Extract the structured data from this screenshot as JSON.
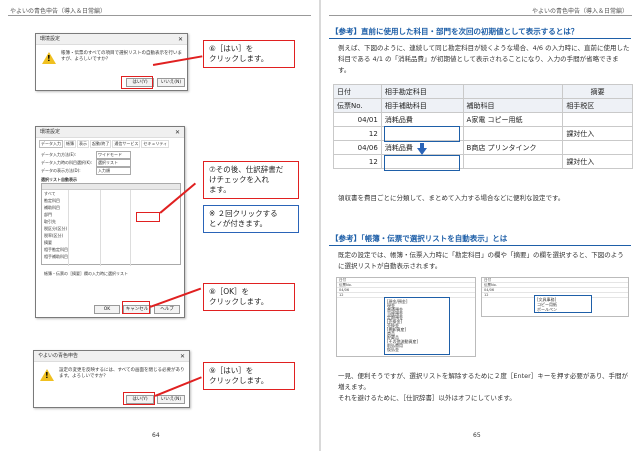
{
  "header_left": "やよいの青色申告（導入＆日常編）",
  "header_right": "やよいの青色申告（導入＆日常編）",
  "page_left": "64",
  "page_right": "65",
  "dialog1": {
    "title": "環境設定",
    "message": "帳簿・伝票のすべての項目で選択リストの自動表示を行いますが、よろしいですか？",
    "yes": "はい(Y)",
    "no": "いいえ(N)"
  },
  "callout6": "⑥［はい］を\nクリックします。",
  "settings": {
    "title": "環境設定",
    "tabs": [
      "データ入力",
      "帳簿",
      "表示",
      "起動/終了",
      "通信サービス",
      "セキュリティ"
    ],
    "rows": [
      {
        "label": "データ入力方法(E):",
        "value": "ワイドモード"
      },
      {
        "label": "データ入力時の科目選択(K):",
        "value": "選択リスト"
      },
      {
        "label": "データの表示方法(D):",
        "value": "入力順"
      }
    ],
    "grid_title": "選択リスト自動表示",
    "grid_headers": [
      "",
      "データ入力伝票",
      "データ出力伝票",
      "振替伝票",
      "帳簿（仕訳帳以外）",
      "仕訳帳"
    ],
    "grid_rows": [
      "すべて",
      "勘定科目",
      "補助科目",
      "部門",
      "取引先",
      "税区分(区分)",
      "税率(区分)",
      "摘要",
      "相手勘定科目",
      "相手補助科目"
    ],
    "checkbox_label": "帳簿・伝票の［摘要］欄の入力時に選択リスト",
    "ok": "OK",
    "cancel": "キャンセル",
    "help": "ヘルプ"
  },
  "callout7": "⑦その後、仕訳辞書だ\nけチェックを入れ\nます。",
  "note_blue": "※ ２回クリックする\nと✓が付きます。",
  "callout8": "⑧［OK］を\nクリックします。",
  "dialog2": {
    "title": "やよいの青色申告",
    "message": "設定の変更を反映するには、すべての画面を閉じる必要があります。よろしいですか？",
    "yes": "はい(Y)",
    "no": "いいえ(N)"
  },
  "callout9": "⑨［はい］を\nクリックします。",
  "section1": {
    "heading": "【参考】直前に使用した科目・部門を次回の初期値として表示するとは？",
    "para": "例えば、下図のように、連続して同じ勘定科目が続くような場合、4/6 の入力時に、直前に使用した科目である 4/1 の「消耗品費」が初期値として表示されることになり、入力の手間が省略できます。",
    "table": {
      "h1": [
        "日付",
        "相手勘定科目",
        "摘要"
      ],
      "h2": [
        "伝票No.",
        "相手補助科目",
        "補助科目",
        "相手税区"
      ],
      "rows": [
        [
          "04/01",
          "消耗品費",
          "A家電  コピー用紙",
          ""
        ],
        [
          "12",
          "",
          "",
          "課対仕入"
        ],
        [
          "04/06",
          "消耗品費",
          "B商店  プリンタインク",
          ""
        ],
        [
          "12",
          "",
          "",
          "課対仕入"
        ]
      ]
    },
    "after": "領収書を費目ごとに分類して、まとめて入力する場合などに便利な設定です。"
  },
  "section2": {
    "heading": "【参考】「帳簿・伝票で選択リストを自動表示」とは",
    "para": "既定の設定では、帳簿・伝票入力時に「勘定科目」の欄や「摘要」の欄を選択すると、下図のように選択リストが自動表示されます。",
    "mini_left": [
      "日付",
      "伝票No.",
      "04/06",
      "12"
    ],
    "mini_list": [
      "[現金/預金]",
      "現金",
      "普通預金",
      "当座預金",
      "定期預金",
      "[売掛金]",
      "売掛金",
      "[棚卸資産]",
      "商品",
      "貯蔵品",
      "[その他流動資産]",
      "前払費用",
      "仮払金"
    ],
    "mini_right": [
      "日付",
      "伝票No.",
      "04/06",
      "12"
    ],
    "mini_list2": [
      "[文具事務]",
      "コピー用紙",
      "ボールペン"
    ],
    "para2": "一見、便利そうですが、選択リストを解除するために２度［Enter］キーを押す必要があり、手間が増えます。\nそれを避けるために、［仕訳辞書］以外はオフにしています。"
  },
  "colors": {
    "red": "#e02020",
    "blue": "#1e5fa8",
    "warning": "#f0c020"
  }
}
